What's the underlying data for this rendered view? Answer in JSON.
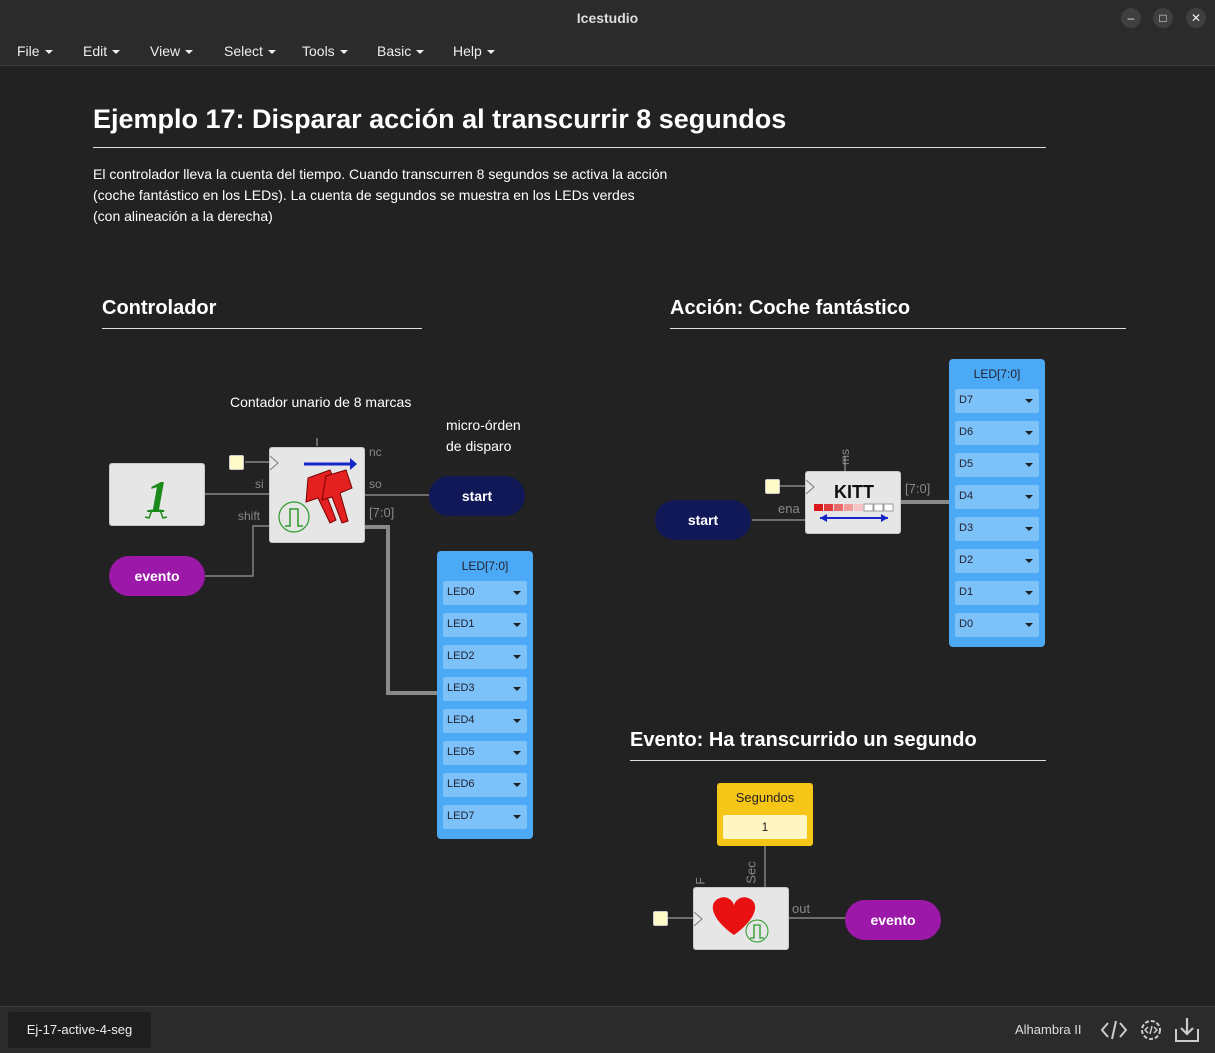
{
  "window": {
    "title": "Icestudio"
  },
  "window_controls": {
    "minimize": "–",
    "maximize": "□",
    "close": "✕"
  },
  "menu": [
    {
      "label": "File"
    },
    {
      "label": "Edit"
    },
    {
      "label": "View"
    },
    {
      "label": "Select"
    },
    {
      "label": "Tools"
    },
    {
      "label": "Basic"
    },
    {
      "label": "Help"
    }
  ],
  "doc": {
    "title": "Ejemplo 17: Disparar acción al transcurrir 8 segundos",
    "description": [
      "El controlador lleva la cuenta del tiempo. Cuando transcurren 8 segundos se activa la acción",
      "(coche fantástico en los LEDs). La cuenta de segundos se muestra en los LEDs verdes",
      "(con alineación a la derecha)"
    ]
  },
  "sections": {
    "controlador": "Controlador",
    "accion": "Acción: Coche fantástico",
    "evento": "Evento: Ha transcurrido un segundo"
  },
  "notes": {
    "contador": "Contador unario de 8 marcas",
    "micro_1": "micro-órden",
    "micro_2": "de disparo"
  },
  "controlador": {
    "one_glyph": "1",
    "shift_ports": {
      "si": "si",
      "shift": "shift",
      "nc": "nc",
      "so": "so",
      "bus": "[7:0]"
    },
    "start_label": "start",
    "evento_label": "evento",
    "led_panel": {
      "title": "LED[7:0]",
      "rows": [
        "LED0",
        "LED1",
        "LED2",
        "LED3",
        "LED4",
        "LED5",
        "LED6",
        "LED7"
      ]
    }
  },
  "accion": {
    "start_label": "start",
    "kitt": {
      "label": "KITT",
      "port_ms": "ms",
      "port_ena": "ena",
      "bus": "[7:0]"
    },
    "led_panel": {
      "title": "LED[7:0]",
      "rows": [
        "D7",
        "D6",
        "D5",
        "D4",
        "D3",
        "D2",
        "D1",
        "D0"
      ]
    }
  },
  "evento": {
    "constant": {
      "title": "Segundos",
      "value": "1"
    },
    "ports": {
      "f": "F",
      "sec": "Sec",
      "out": "out"
    },
    "evento_label": "evento"
  },
  "status": {
    "file": "Ej-17-active-4-seg",
    "board": "Alhambra II"
  },
  "colors": {
    "navy_pill": "#101858",
    "purple_pill": "#9b18a8",
    "led_panel": "#4ca9f5",
    "constant": "#f5c518"
  }
}
